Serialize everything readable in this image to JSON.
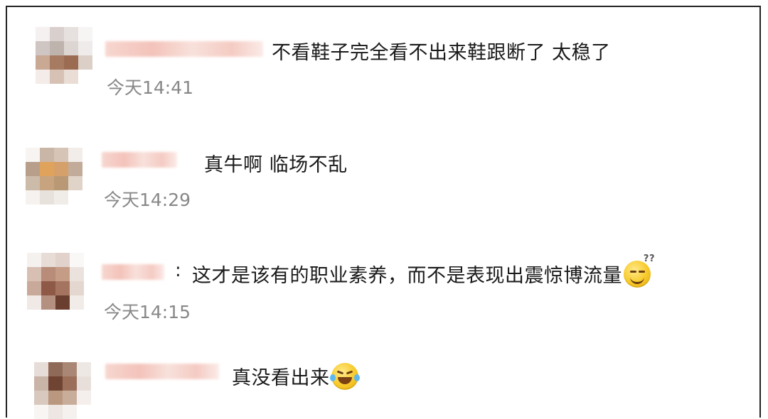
{
  "comments": [
    {
      "text": "不看鞋子完全看不出来鞋跟断了 太稳了",
      "time": "今天14:41",
      "emoji": ""
    },
    {
      "text": "真牛啊 临场不乱",
      "time": "今天14:29",
      "emoji": ""
    },
    {
      "text": "这才是该有的职业素养，而不是表现出震惊博流量",
      "time": "今天14:15",
      "emoji": "smirk-question-emoji"
    },
    {
      "text": "真没看出来",
      "time": "",
      "emoji": "laugh-tears-emoji"
    }
  ],
  "separator": ":"
}
